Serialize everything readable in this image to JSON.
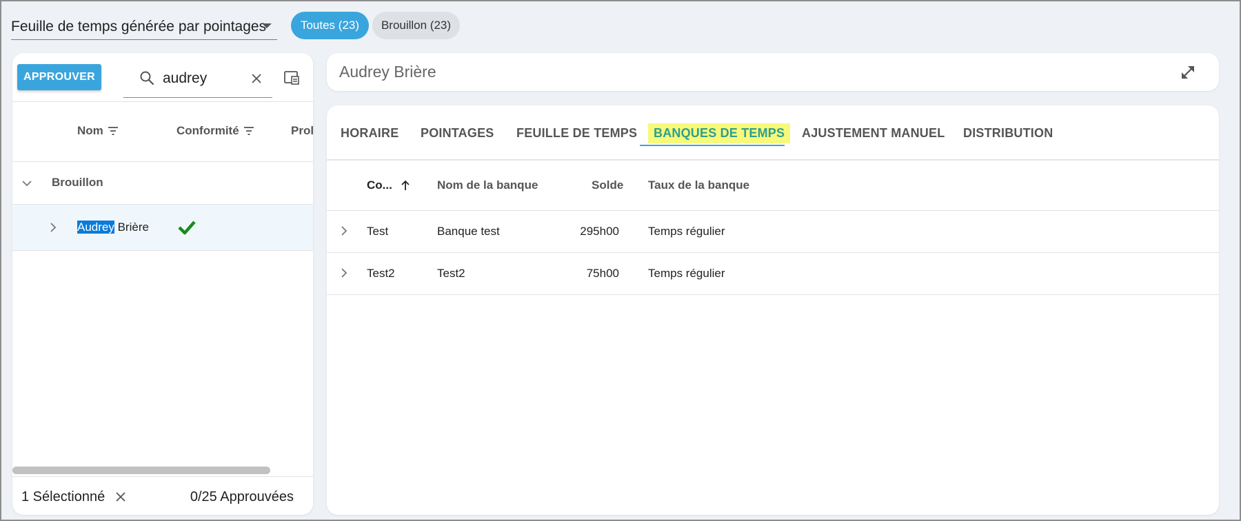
{
  "top_bar": {
    "view_select": "Feuille de temps générée par pointages",
    "chips": {
      "all": "Toutes (23)",
      "draft": "Brouillon (23)"
    }
  },
  "left_panel": {
    "approve_button": "APPROUVER",
    "search_value": "audrey",
    "columns": {
      "name": "Nom",
      "compliance": "Conformité",
      "profile_partial": "Prol"
    },
    "group": {
      "label": "Brouillon"
    },
    "employee": {
      "highlight": "Audrey",
      "rest": " Brière",
      "compliant": true
    },
    "footer": {
      "selected": "1 Sélectionné",
      "approved": "0/25 Approuvées"
    }
  },
  "right_panel": {
    "title": "Audrey Brière",
    "tabs": [
      {
        "label": "HORAIRE"
      },
      {
        "label": "POINTAGES"
      },
      {
        "label": "FEUILLE DE TEMPS"
      },
      {
        "label": "BANQUES DE TEMPS",
        "active": true
      },
      {
        "label": "AJUSTEMENT MANUEL"
      },
      {
        "label": "DISTRIBUTION"
      }
    ],
    "table": {
      "headers": {
        "code": "Co...",
        "bank_name": "Nom de la banque",
        "balance": "Solde",
        "rate": "Taux de la banque"
      },
      "rows": [
        {
          "code": "Test",
          "bank_name": "Banque test",
          "balance": "295h00",
          "rate": "Temps régulier"
        },
        {
          "code": "Test2",
          "bank_name": "Test2",
          "balance": "75h00",
          "rate": "Temps régulier"
        }
      ]
    }
  },
  "colors": {
    "accent": "#3aa5dd",
    "active_tab_text": "#2e9e8f",
    "active_tab_highlight": "#f7f97a",
    "check": "#1a8a1a",
    "selection_highlight": "#0a7bd8",
    "background": "#eef1f6"
  },
  "icons": [
    "dropdown-caret-icon",
    "search-icon",
    "close-icon",
    "columns-icon",
    "filter-icon",
    "chevron-down-icon",
    "chevron-right-icon",
    "checkmark-icon",
    "expand-icon",
    "sort-ascending-icon"
  ]
}
